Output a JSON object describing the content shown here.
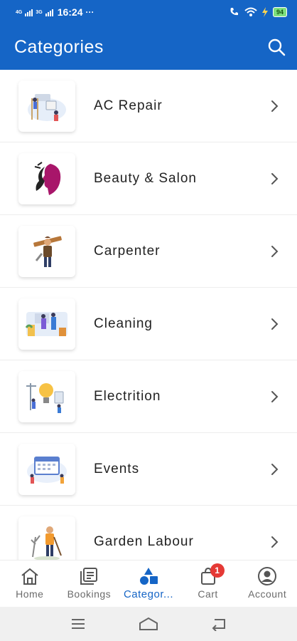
{
  "status_bar": {
    "network_top": "4G",
    "network_bottom": "3G",
    "time": "16:24",
    "dots": "···",
    "battery": "94"
  },
  "app_bar": {
    "title": "Categories",
    "search_icon": "search-icon"
  },
  "categories": [
    {
      "label": "AC Repair",
      "icon": "ac-repair-illustration"
    },
    {
      "label": "Beauty & Salon",
      "icon": "beauty-salon-illustration"
    },
    {
      "label": "Carpenter",
      "icon": "carpenter-illustration"
    },
    {
      "label": "Cleaning",
      "icon": "cleaning-illustration"
    },
    {
      "label": "Electrition",
      "icon": "electrician-illustration"
    },
    {
      "label": "Events",
      "icon": "events-illustration"
    },
    {
      "label": "Garden Labour",
      "icon": "garden-labour-illustration"
    }
  ],
  "bottom_nav": [
    {
      "label": "Home",
      "icon": "home-icon"
    },
    {
      "label": "Bookings",
      "icon": "bookings-icon"
    },
    {
      "label": "Categor...",
      "icon": "categories-icon",
      "active": true
    },
    {
      "label": "Cart",
      "icon": "cart-icon",
      "badge": "1"
    },
    {
      "label": "Account",
      "icon": "account-icon"
    }
  ],
  "colors": {
    "primary": "#1565c6",
    "badge": "#e53935",
    "battery": "#7ee07e"
  }
}
